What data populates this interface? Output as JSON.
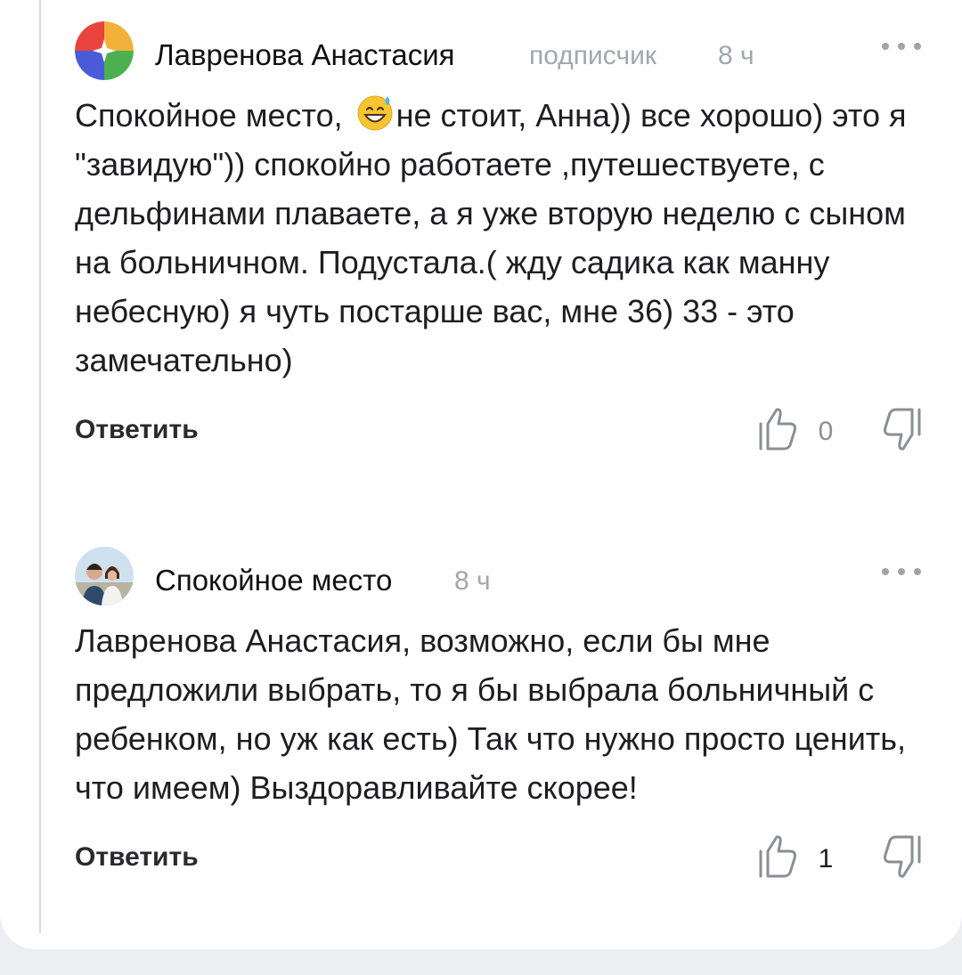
{
  "comments": [
    {
      "author": "Лавренова Анастасия",
      "badge": "подписчик",
      "time": "8 ч",
      "text_before_emoji": "Спокойное место, ",
      "emoji": "grinning-sweat-emoji",
      "text_after_emoji": "не стоит, Анна)) все хорошо) это я \"завидую\")) спокойно работаете ,путешествуете, с дельфинами плаваете, а я уже вторую неделю с сыном на больничном. Подустала.( жду садика как манну небесную) я чуть постарше вас, мне 36) 33 - это замечательно)",
      "reply_label": "Ответить",
      "likes": "0",
      "avatar_icon": "colorful-circle-avatar-icon"
    },
    {
      "author": "Спокойное место",
      "time": "8 ч",
      "text": "Лавренова Анастасия, возможно, если бы мне предложили выбрать, то я бы выбрала больничный с ребенком, но уж как есть) Так что нужно просто ценить, что имеем) Выздоравливайте скорее!",
      "reply_label": "Ответить",
      "likes": "1",
      "avatar_icon": "couple-photo-avatar"
    }
  ],
  "icons": {
    "more": "more-dots-icon",
    "like": "thumb-up-icon",
    "dislike": "thumb-down-icon"
  }
}
